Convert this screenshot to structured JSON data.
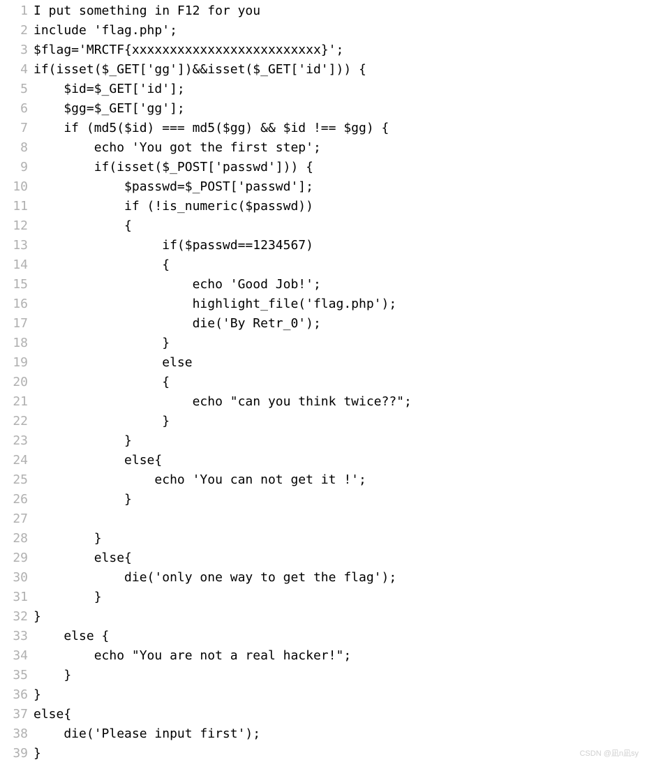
{
  "code": {
    "lines": [
      "I put something in F12 for you",
      "include 'flag.php';",
      "$flag='MRCTF{xxxxxxxxxxxxxxxxxxxxxxxxx}';",
      "if(isset($_GET['gg'])&&isset($_GET['id'])) {",
      "    $id=$_GET['id'];",
      "    $gg=$_GET['gg'];",
      "    if (md5($id) === md5($gg) && $id !== $gg) {",
      "        echo 'You got the first step';",
      "        if(isset($_POST['passwd'])) {",
      "            $passwd=$_POST['passwd'];",
      "            if (!is_numeric($passwd))",
      "            {",
      "                 if($passwd==1234567)",
      "                 {",
      "                     echo 'Good Job!';",
      "                     highlight_file('flag.php');",
      "                     die('By Retr_0');",
      "                 }",
      "                 else",
      "                 {",
      "                     echo \"can you think twice??\";",
      "                 }",
      "            }",
      "            else{",
      "                echo 'You can not get it !';",
      "            }",
      "",
      "        }",
      "        else{",
      "            die('only one way to get the flag');",
      "        }",
      "}",
      "    else {",
      "        echo \"You are not a real hacker!\";",
      "    }",
      "}",
      "else{",
      "    die('Please input first');",
      "}"
    ]
  },
  "watermark": "CSDN @凪n凪sy"
}
